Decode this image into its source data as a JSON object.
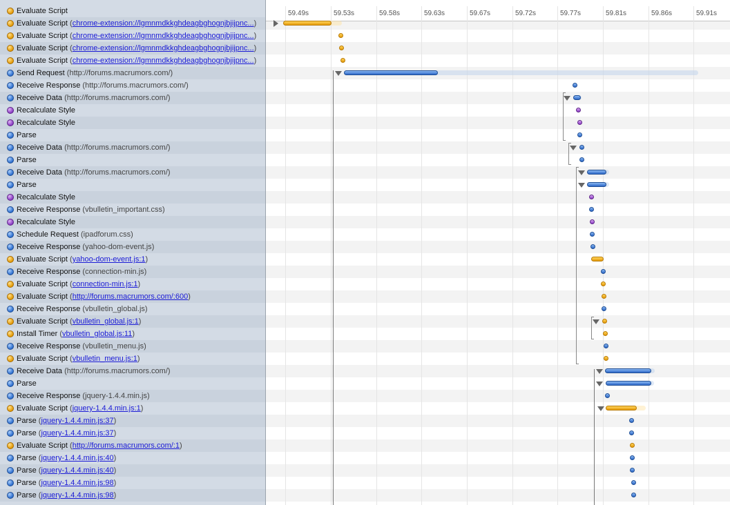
{
  "timeline": {
    "ticks": [
      "59.49s",
      "59.53s",
      "59.58s",
      "59.63s",
      "59.67s",
      "59.72s",
      "59.77s",
      "59.81s",
      "59.86s",
      "59.91s"
    ],
    "records": [
      {
        "name": "Evaluate Script",
        "detail": "",
        "link": false,
        "color": "orange"
      },
      {
        "name": "Evaluate Script",
        "detail": "chrome-extension://lgmnmdkkghdeagbghognjbjijpnc...",
        "link": true,
        "color": "orange"
      },
      {
        "name": "Evaluate Script",
        "detail": "chrome-extension://lgmnmdkkghdeagbghognjbjijpnc...",
        "link": true,
        "color": "orange"
      },
      {
        "name": "Evaluate Script",
        "detail": "chrome-extension://lgmnmdkkghdeagbghognjbjijpnc...",
        "link": true,
        "color": "orange"
      },
      {
        "name": "Evaluate Script",
        "detail": "chrome-extension://lgmnmdkkghdeagbghognjbjijpnc...",
        "link": true,
        "color": "orange"
      },
      {
        "name": "Send Request",
        "detail": "http://forums.macrumors.com/",
        "link": false,
        "color": "blue"
      },
      {
        "name": "Receive Response",
        "detail": "http://forums.macrumors.com/",
        "link": false,
        "color": "blue"
      },
      {
        "name": "Receive Data",
        "detail": "http://forums.macrumors.com/",
        "link": false,
        "color": "blue"
      },
      {
        "name": "Recalculate Style",
        "detail": "",
        "link": false,
        "color": "purple"
      },
      {
        "name": "Recalculate Style",
        "detail": "",
        "link": false,
        "color": "purple"
      },
      {
        "name": "Parse",
        "detail": "",
        "link": false,
        "color": "blue"
      },
      {
        "name": "Receive Data",
        "detail": "http://forums.macrumors.com/",
        "link": false,
        "color": "blue"
      },
      {
        "name": "Parse",
        "detail": "",
        "link": false,
        "color": "blue"
      },
      {
        "name": "Receive Data",
        "detail": "http://forums.macrumors.com/",
        "link": false,
        "color": "blue"
      },
      {
        "name": "Parse",
        "detail": "",
        "link": false,
        "color": "blue"
      },
      {
        "name": "Recalculate Style",
        "detail": "",
        "link": false,
        "color": "purple"
      },
      {
        "name": "Receive Response",
        "detail": "vbulletin_important.css",
        "link": false,
        "color": "blue"
      },
      {
        "name": "Recalculate Style",
        "detail": "",
        "link": false,
        "color": "purple"
      },
      {
        "name": "Schedule Request",
        "detail": "ipadforum.css",
        "link": false,
        "color": "blue"
      },
      {
        "name": "Receive Response",
        "detail": "yahoo-dom-event.js",
        "link": false,
        "color": "blue"
      },
      {
        "name": "Evaluate Script",
        "detail": "yahoo-dom-event.js:1",
        "link": true,
        "color": "orange"
      },
      {
        "name": "Receive Response",
        "detail": "connection-min.js",
        "link": false,
        "color": "blue"
      },
      {
        "name": "Evaluate Script",
        "detail": "connection-min.js:1",
        "link": true,
        "color": "orange"
      },
      {
        "name": "Evaluate Script",
        "detail": "http://forums.macrumors.com/:600",
        "link": true,
        "color": "orange"
      },
      {
        "name": "Receive Response",
        "detail": "vbulletin_global.js",
        "link": false,
        "color": "blue"
      },
      {
        "name": "Evaluate Script",
        "detail": "vbulletin_global.js:1",
        "link": true,
        "color": "orange"
      },
      {
        "name": "Install Timer",
        "detail": "vbulletin_global.js:11",
        "link": true,
        "color": "orange"
      },
      {
        "name": "Receive Response",
        "detail": "vbulletin_menu.js",
        "link": false,
        "color": "blue"
      },
      {
        "name": "Evaluate Script",
        "detail": "vbulletin_menu.js:1",
        "link": true,
        "color": "orange"
      },
      {
        "name": "Receive Data",
        "detail": "http://forums.macrumors.com/",
        "link": false,
        "color": "blue"
      },
      {
        "name": "Parse",
        "detail": "",
        "link": false,
        "color": "blue"
      },
      {
        "name": "Receive Response",
        "detail": "jquery-1.4.4.min.js",
        "link": false,
        "color": "blue"
      },
      {
        "name": "Evaluate Script",
        "detail": "jquery-1.4.4.min.js:1",
        "link": true,
        "color": "orange"
      },
      {
        "name": "Parse",
        "detail": "jquery-1.4.4.min.js:37",
        "link": true,
        "color": "blue"
      },
      {
        "name": "Parse",
        "detail": "jquery-1.4.4.min.js:37",
        "link": true,
        "color": "blue"
      },
      {
        "name": "Evaluate Script",
        "detail": "http://forums.macrumors.com/:1",
        "link": true,
        "color": "orange"
      },
      {
        "name": "Parse",
        "detail": "jquery-1.4.4.min.js:40",
        "link": true,
        "color": "blue"
      },
      {
        "name": "Parse",
        "detail": "jquery-1.4.4.min.js:40",
        "link": true,
        "color": "blue"
      },
      {
        "name": "Parse",
        "detail": "jquery-1.4.4.min.js:98",
        "link": true,
        "color": "blue"
      },
      {
        "name": "Parse",
        "detail": "jquery-1.4.4.min.js:98",
        "link": true,
        "color": "blue"
      }
    ]
  }
}
